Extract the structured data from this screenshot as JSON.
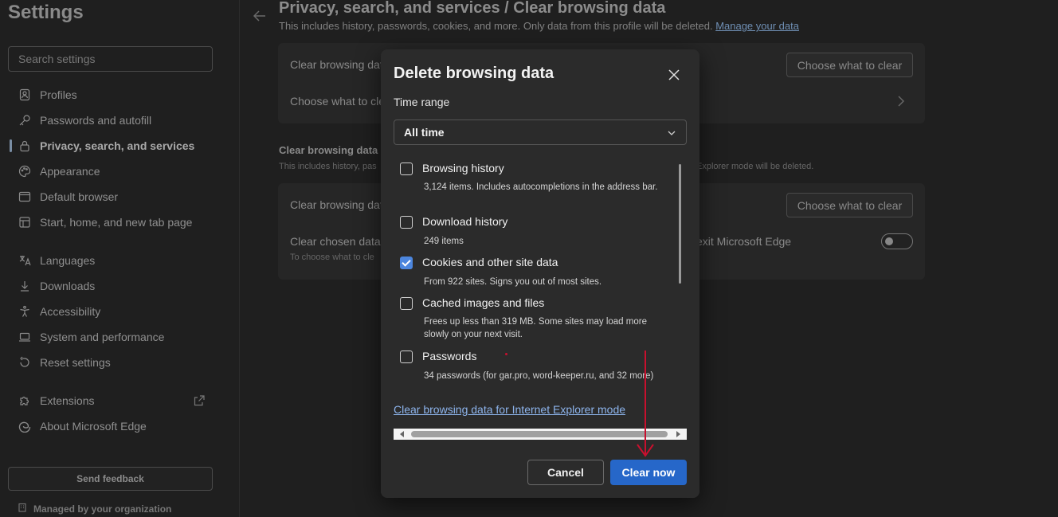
{
  "sidebar": {
    "title": "Settings",
    "search_placeholder": "Search settings",
    "items": [
      {
        "label": "Profiles",
        "icon": "profile-icon"
      },
      {
        "label": "Passwords and autofill",
        "icon": "key-icon"
      },
      {
        "label": "Privacy, search, and services",
        "icon": "lock-icon",
        "active": true
      },
      {
        "label": "Appearance",
        "icon": "palette-icon"
      },
      {
        "label": "Default browser",
        "icon": "browser-icon"
      },
      {
        "label": "Start, home, and new tab page",
        "icon": "home-icon"
      },
      {
        "label": "Languages",
        "icon": "language-icon"
      },
      {
        "label": "Downloads",
        "icon": "download-icon"
      },
      {
        "label": "Accessibility",
        "icon": "accessibility-icon"
      },
      {
        "label": "System and performance",
        "icon": "laptop-icon"
      },
      {
        "label": "Reset settings",
        "icon": "reset-icon"
      },
      {
        "label": "Extensions",
        "icon": "puzzle-icon"
      },
      {
        "label": "About Microsoft Edge",
        "icon": "edge-icon"
      }
    ],
    "send_feedback": "Send feedback",
    "managed": "Managed by your organization"
  },
  "main": {
    "title": "Privacy, search, and services / Clear browsing data",
    "subtitle": "This includes history, passwords, cookies, and more. Only data from this profile will be deleted.",
    "manage_link": "Manage your data",
    "card1": {
      "row1": "Clear browsing dat",
      "button": "Choose what to clear",
      "row2": "Choose what to cle"
    },
    "section": {
      "title": "Clear browsing data",
      "subtitle_left": "This includes history, pas",
      "subtitle_right": "Explorer mode will be deleted."
    },
    "card2": {
      "row1": "Clear browsing dat",
      "button": "Choose what to clear",
      "row2": "Clear chosen data",
      "row2_right": "exit Microsoft Edge",
      "row2_sub": "To choose what to cle"
    }
  },
  "dialog": {
    "title": "Delete browsing data",
    "time_range_label": "Time range",
    "time_range_value": "All time",
    "items": [
      {
        "label": "Browsing history",
        "desc": "3,124 items. Includes autocompletions in the address bar.",
        "checked": false
      },
      {
        "label": "Download history",
        "desc": "249 items",
        "checked": false
      },
      {
        "label": "Cookies and other site data",
        "desc": "From 922 sites. Signs you out of most sites.",
        "checked": true
      },
      {
        "label": "Cached images and files",
        "desc": "Frees up less than 319 MB. Some sites may load more slowly on your next visit.",
        "checked": false
      },
      {
        "label": "Passwords",
        "desc": "34 passwords (for gar.pro, word-keeper.ru, and 32 more)",
        "checked": false
      }
    ],
    "ie_link": "Clear browsing data for Internet Explorer mode",
    "cancel": "Cancel",
    "clear_now": "Clear now"
  },
  "colors": {
    "primary_button": "#2667c9",
    "checkbox_checked": "#4c86de",
    "link": "#8db4ec",
    "annotation_arrow": "#c8102e"
  }
}
